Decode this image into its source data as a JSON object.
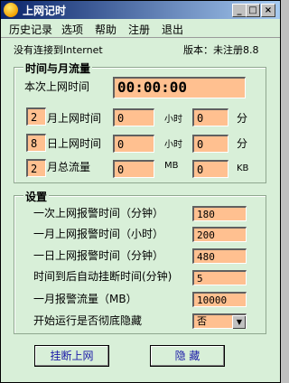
{
  "window": {
    "title": "上网记时",
    "controls": {
      "minimize": "_",
      "restore": "□",
      "close": "×"
    }
  },
  "menu": [
    "历史记录",
    "选项",
    "帮助",
    "注册",
    "退出"
  ],
  "status": {
    "connection": "没有连接到Internet",
    "version": "版本：未注册8.8"
  },
  "traffic": {
    "title": "时间与月流量",
    "session_label": "本次上网时间",
    "session_value": "00:00:00",
    "month_index": "2",
    "month_label": "月上网时间",
    "day_index": "8",
    "day_label": "日上网时间",
    "flow_index": "2",
    "flow_label": "月总流量",
    "unit_hour": "小时",
    "unit_min": "分",
    "unit_mb": "MB",
    "unit_kb": "KB",
    "month_hours": "0",
    "month_mins": "0",
    "day_hours": "0",
    "day_mins": "0",
    "flow_mb": "0",
    "flow_kb": "0"
  },
  "settings": {
    "title": "设置",
    "rows": [
      {
        "label": "一次上网报警时间（分钟）",
        "value": "180"
      },
      {
        "label": "一月上网报警时间（小时）",
        "value": "200"
      },
      {
        "label": "一日上网报警时间（分钟）",
        "value": "480"
      },
      {
        "label": "时间到后自动挂断时间(分钟)",
        "value": "5"
      },
      {
        "label": "一月报警流量（MB）",
        "value": "10000"
      }
    ],
    "hide_label": "开始运行是否彻底隐藏",
    "hide_value": "否"
  },
  "buttons": {
    "hangup": "挂断上网",
    "hide": "隐  藏"
  }
}
